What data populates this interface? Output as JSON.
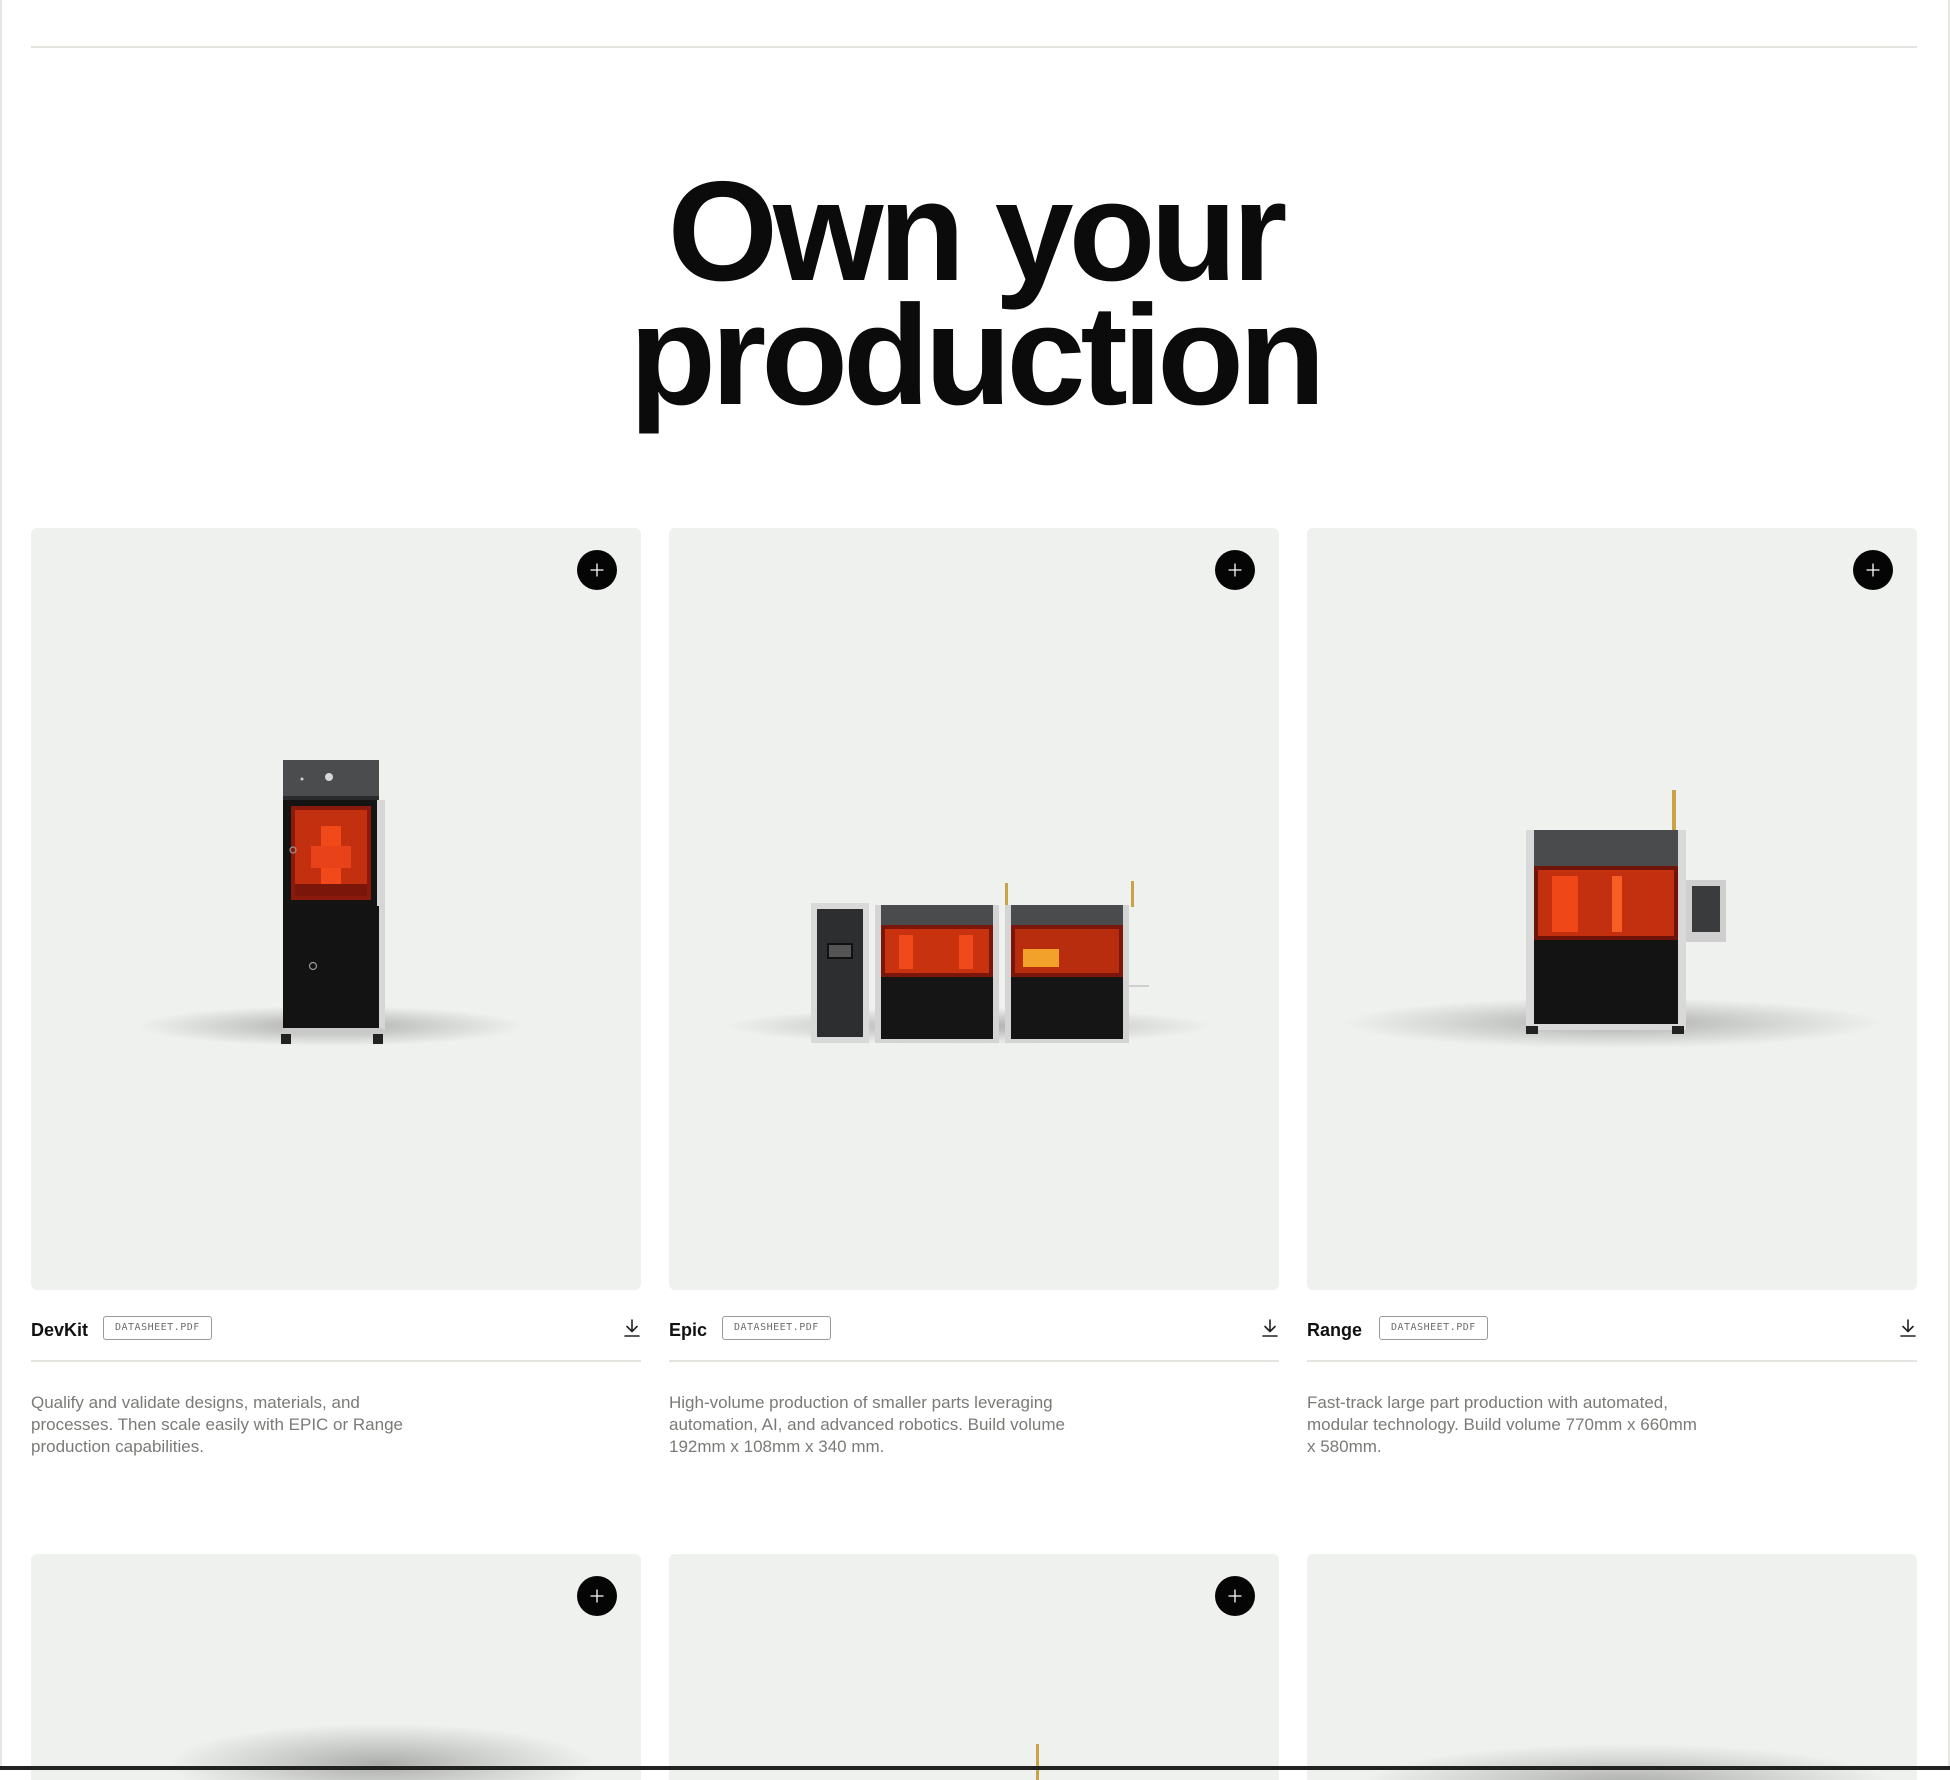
{
  "headline": {
    "line1": "Own your",
    "line2": "production"
  },
  "products": [
    {
      "name": "DevKit",
      "datasheet": "DATASHEET.PDF",
      "description": "Qualify and validate designs, materials, and processes. Then scale easily with EPIC or Range production capabilities.",
      "image": "devkit-printer"
    },
    {
      "name": "Epic",
      "datasheet": "DATASHEET.PDF",
      "description": "High-volume production of smaller parts leveraging automation, AI, and advanced robotics. Build volume 192mm x 108mm x 340 mm.",
      "image": "epic-production-line"
    },
    {
      "name": "Range",
      "datasheet": "DATASHEET.PDF",
      "description": "Fast-track large part production with automated, modular technology. Build volume 770mm x 660mm x 580mm.",
      "image": "range-printer"
    }
  ],
  "icons": {
    "expand": "plus-icon",
    "download": "download-icon"
  },
  "colors": {
    "card_bg": "#eff1ee",
    "accent": "#d8381a",
    "button": "#050505"
  }
}
